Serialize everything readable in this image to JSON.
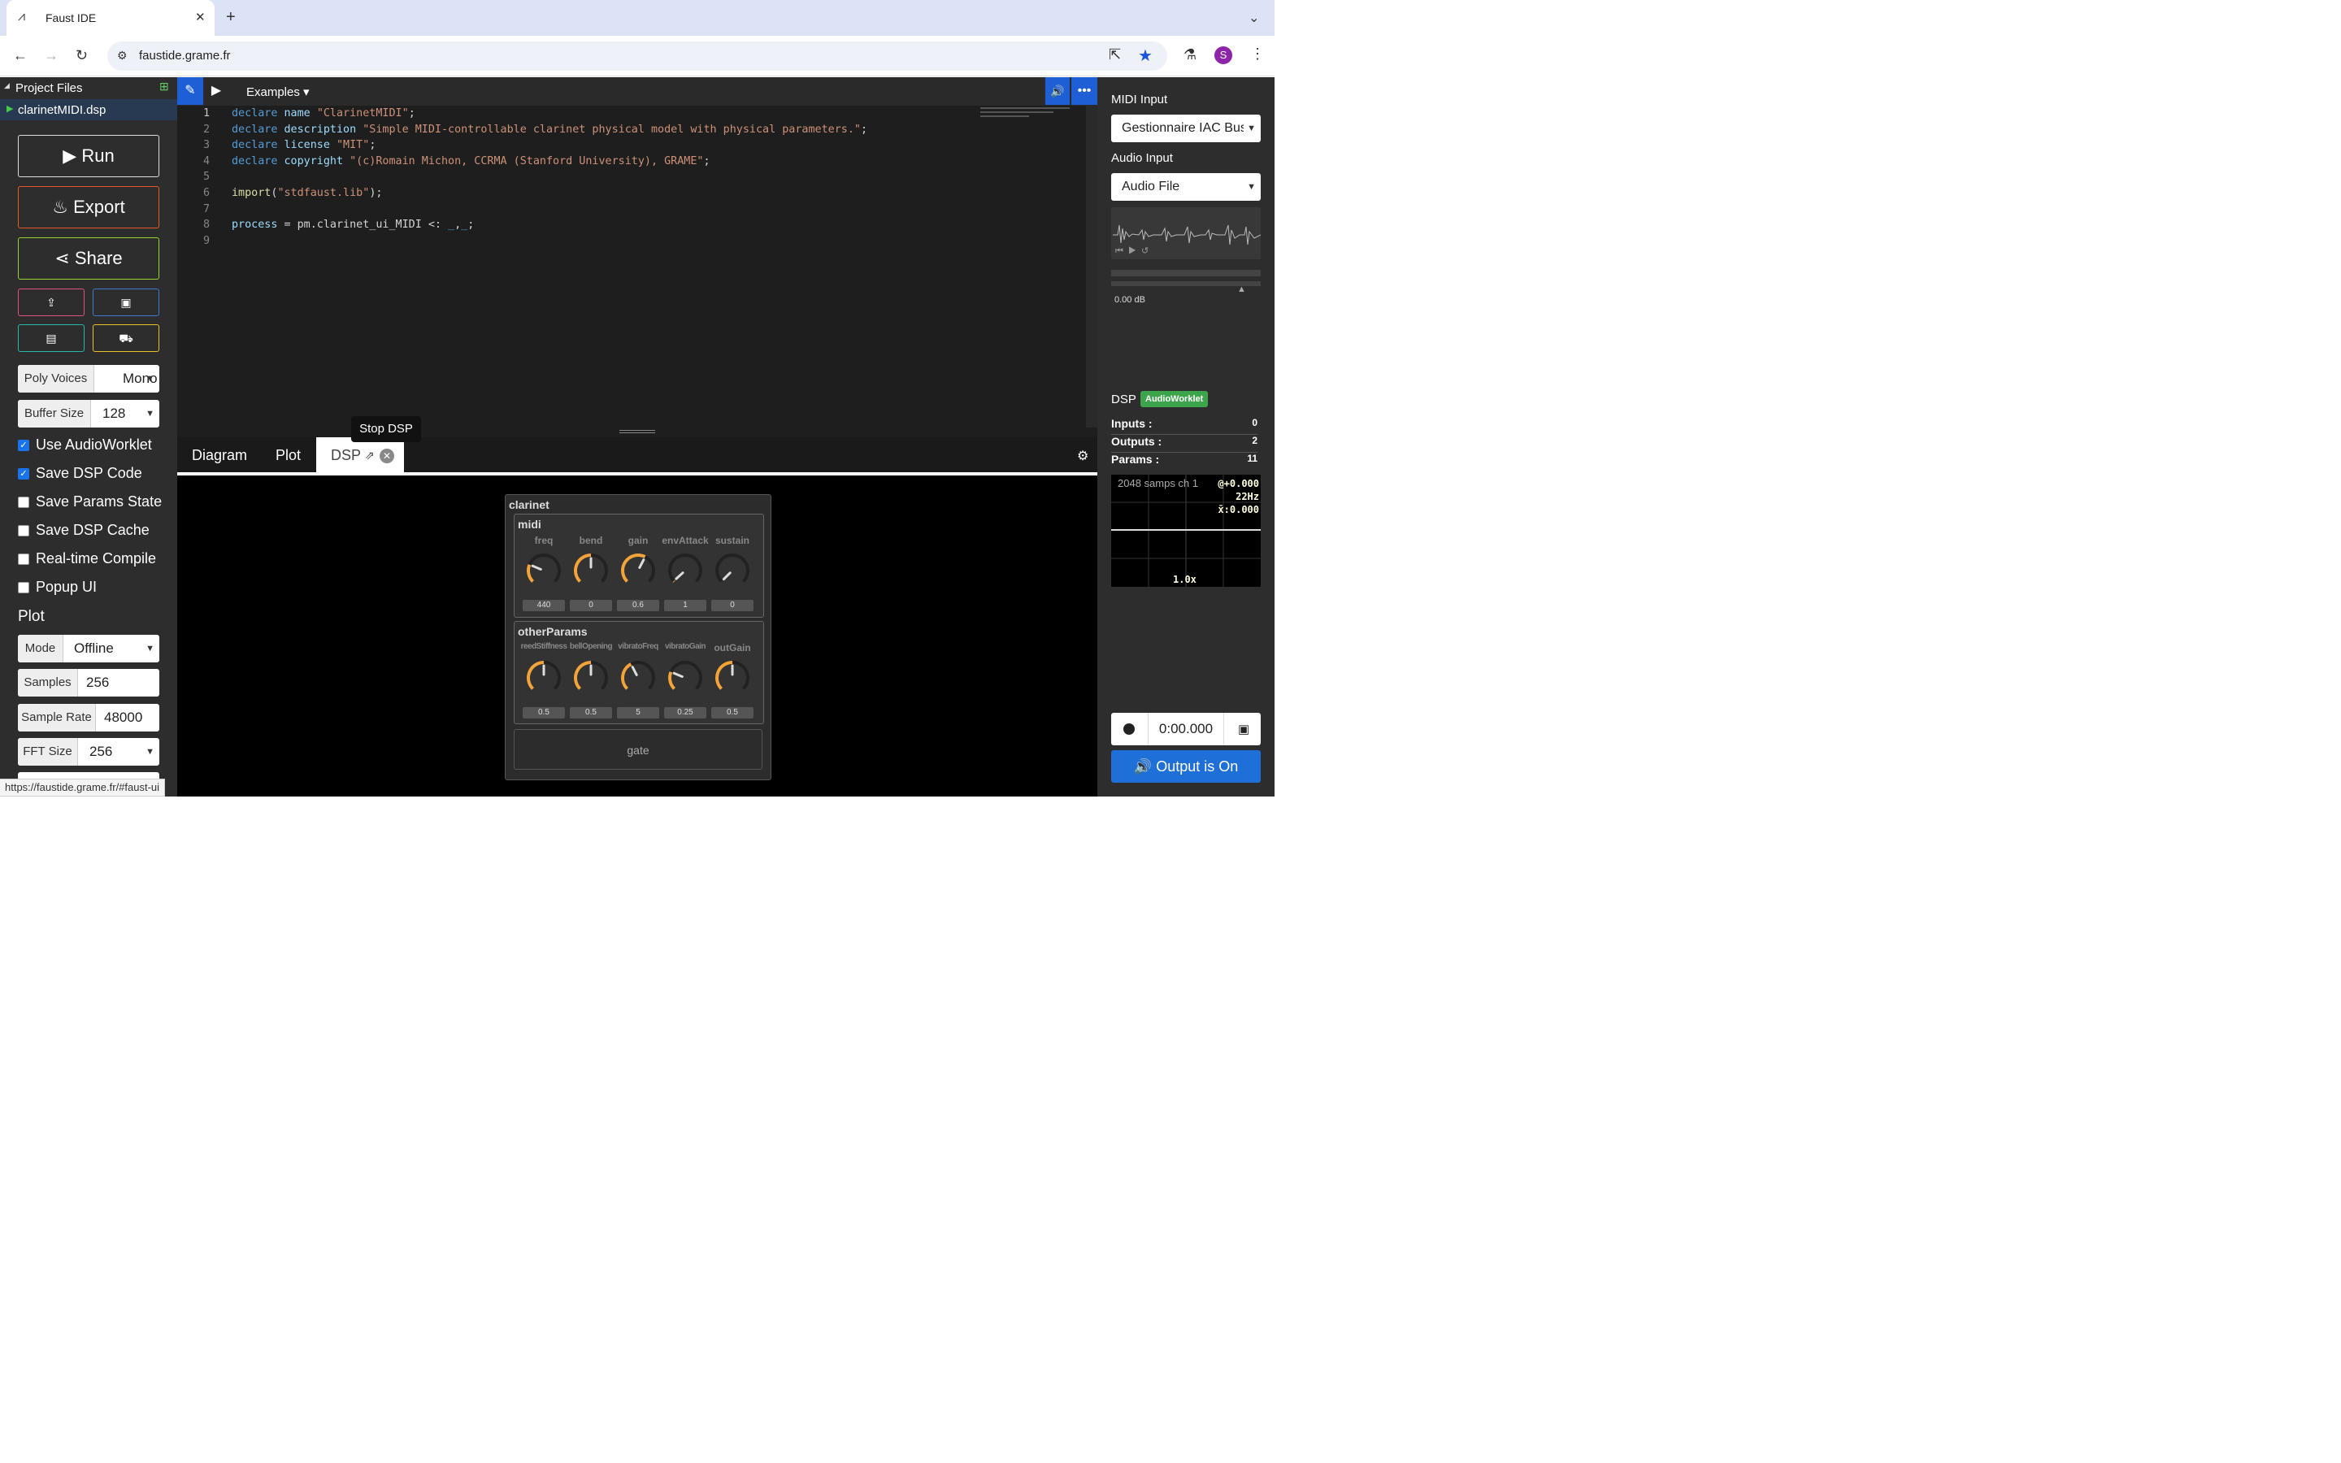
{
  "browser": {
    "tab_title": "Faust IDE",
    "tab_close": "✕",
    "new_tab": "+",
    "url": "faustide.grame.fr",
    "status_url": "https://faustide.grame.fr/#faust-ui"
  },
  "project": {
    "title": "Project Files",
    "file": "clarinetMIDI.dsp"
  },
  "actions": {
    "run": "Run",
    "export": "Export",
    "share": "Share"
  },
  "options": {
    "poly_voices_label": "Poly Voices",
    "poly_voices_value": "Mono",
    "buffer_size_label": "Buffer Size",
    "buffer_size_value": "128",
    "checkboxes": [
      {
        "label": "Use AudioWorklet",
        "checked": true
      },
      {
        "label": "Save DSP Code",
        "checked": true
      },
      {
        "label": "Save Params State",
        "checked": false
      },
      {
        "label": "Save DSP Cache",
        "checked": false
      },
      {
        "label": "Real-time Compile",
        "checked": false
      },
      {
        "label": "Popup UI",
        "checked": false
      }
    ]
  },
  "plot": {
    "title": "Plot",
    "mode_label": "Mode",
    "mode_value": "Offline",
    "samples_label": "Samples",
    "samples_value": "256",
    "sample_rate_label": "Sample Rate",
    "sample_rate_value": "48000",
    "fft_size_label": "FFT Size",
    "fft_size_value": "256"
  },
  "editor": {
    "examples_label": "Examples ▾",
    "lines": [
      "1",
      "2",
      "3",
      "4",
      "5",
      "6",
      "7",
      "8",
      "9"
    ]
  },
  "bottom_tabs": {
    "diagram": "Diagram",
    "plot": "Plot",
    "dsp": "DSP",
    "tooltip": "Stop DSP"
  },
  "faust_ui": {
    "title": "clarinet",
    "groups": [
      {
        "title": "midi",
        "knobs": [
          {
            "label": "freq",
            "value": "440",
            "fraction": 0.25
          },
          {
            "label": "bend",
            "value": "0",
            "fraction": 0.5
          },
          {
            "label": "gain",
            "value": "0.6",
            "fraction": 0.6
          },
          {
            "label": "envAttack",
            "value": "1",
            "fraction": 0.01
          },
          {
            "label": "sustain",
            "value": "0",
            "fraction": 0.0
          }
        ]
      },
      {
        "title": "otherParams",
        "knobs": [
          {
            "label": "reedStiffness",
            "value": "0.5",
            "fraction": 0.5
          },
          {
            "label": "bellOpening",
            "value": "0.5",
            "fraction": 0.5
          },
          {
            "label": "vibratoFreq",
            "value": "5",
            "fraction": 0.4
          },
          {
            "label": "vibratoGain",
            "value": "0.25",
            "fraction": 0.25
          },
          {
            "label": "outGain",
            "value": "0.5",
            "fraction": 0.5
          }
        ]
      }
    ],
    "gate": "gate"
  },
  "right": {
    "midi_input_label": "MIDI Input",
    "midi_input_value": "Gestionnaire IAC Bus",
    "audio_input_label": "Audio Input",
    "audio_input_value": "Audio File",
    "level": "0.00 dB",
    "dsp_label": "DSP",
    "dsp_badge": "AudioWorklet",
    "inputs_label": "Inputs :",
    "inputs_value": "0",
    "outputs_label": "Outputs :",
    "outputs_value": "2",
    "params_label": "Params :",
    "params_value": "11",
    "scope_info": "2048 samps ch 1",
    "scope_r1": "@+0.000",
    "scope_r2": "22Hz",
    "scope_r3": "x̄:0.000",
    "scope_zoom": "1.0x",
    "rec_time": "0:00.000",
    "output_button": "Output is On"
  },
  "colors": {
    "accent": "#1e6fd8",
    "knob_orange": "#f2a33a",
    "badge_green": "#3ca54b"
  }
}
